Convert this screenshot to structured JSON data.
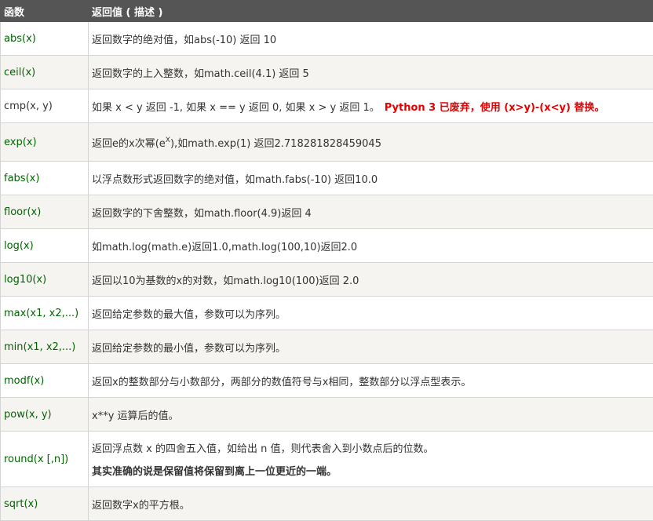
{
  "header": {
    "col_function": "函数",
    "col_desc": "返回值 ( 描述 )"
  },
  "rows": [
    {
      "fn": "abs(x)",
      "desc": "返回数字的绝对值，如abs(-10) 返回 10"
    },
    {
      "fn": "ceil(x)",
      "desc": "返回数字的上入整数，如math.ceil(4.1) 返回 5"
    },
    {
      "fn": "cmp(x, y)",
      "desc": "如果 x < y 返回 -1, 如果 x == y 返回 0, 如果 x > y 返回 1。",
      "note": "Python 3 已废弃，使用 (x>y)-(x<y) 替换。"
    },
    {
      "fn": "exp(x)",
      "desc_pre": "返回e的x次幂(e",
      "desc_sup": "X",
      "desc_post": "),如math.exp(1) 返回2.718281828459045"
    },
    {
      "fn": "fabs(x)",
      "desc": "以浮点数形式返回数字的绝对值，如math.fabs(-10) 返回10.0"
    },
    {
      "fn": "floor(x)",
      "desc": "返回数字的下舍整数，如math.floor(4.9)返回 4"
    },
    {
      "fn": "log(x)",
      "desc": "如math.log(math.e)返回1.0,math.log(100,10)返回2.0"
    },
    {
      "fn": "log10(x)",
      "desc": "返回以10为基数的x的对数，如math.log10(100)返回 2.0"
    },
    {
      "fn": "max(x1, x2,...)",
      "desc": "返回给定参数的最大值，参数可以为序列。"
    },
    {
      "fn": "min(x1, x2,...)",
      "desc": "返回给定参数的最小值，参数可以为序列。"
    },
    {
      "fn": "modf(x)",
      "desc": "返回x的整数部分与小数部分，两部分的数值符号与x相同，整数部分以浮点型表示。"
    },
    {
      "fn": "pow(x, y)",
      "desc": "x**y 运算后的值。"
    },
    {
      "fn": "round(x [,n])",
      "desc": "返回浮点数 x 的四舍五入值，如给出 n 值，则代表舍入到小数点后的位数。",
      "note": "其实准确的说是保留值将保留到离上一位更近的一端。"
    },
    {
      "fn": "sqrt(x)",
      "desc": "返回数字x的平方根。"
    }
  ]
}
